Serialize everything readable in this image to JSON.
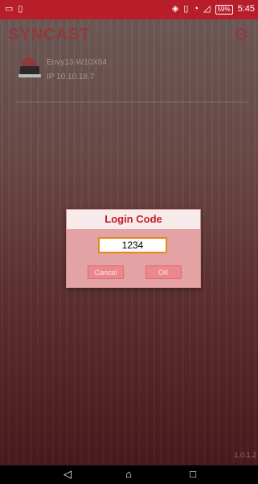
{
  "status_bar": {
    "time": "5:45",
    "battery_percent": "59%",
    "left_icons": [
      "sim-card-icon",
      "notification-icon"
    ],
    "right_icons": [
      "vibrate-icon",
      "sim-icon",
      "wifi-icon",
      "signal-icon"
    ]
  },
  "app": {
    "logo": "SYNCAST",
    "settings_icon": "gear-icon",
    "device": {
      "name": "Envy13-W10X64",
      "ip": "IP 10.10.18.7",
      "icon": "device-icon"
    },
    "version": "1.0.1.2"
  },
  "dialog": {
    "title": "Login Code",
    "code_value": "1234",
    "cancel_label": "Cancel",
    "ok_label": "OK",
    "accent": "#c61c2a"
  },
  "navbar": {
    "back_icon": "back-icon",
    "home_icon": "home-icon",
    "recent_icon": "recent-apps-icon"
  }
}
